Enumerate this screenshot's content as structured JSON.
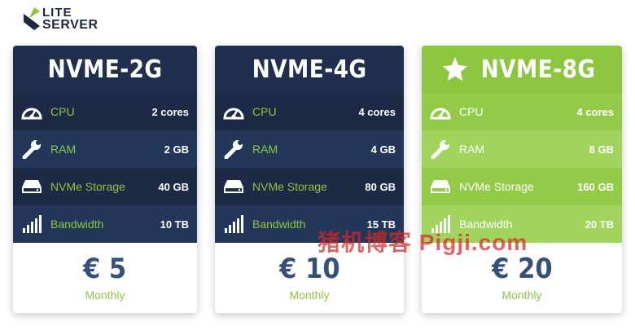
{
  "brand": {
    "line1": "LITE",
    "line2": "SERVER"
  },
  "plans": [
    {
      "name": "NVME-2G",
      "specs": [
        {
          "label": "CPU",
          "value": "2 cores",
          "icon": "speedometer-icon"
        },
        {
          "label": "RAM",
          "value": "2 GB",
          "icon": "wrench-icon"
        },
        {
          "label": "NVMe Storage",
          "value": "40 GB",
          "icon": "hard-drive-icon"
        },
        {
          "label": "Bandwidth",
          "value": "10 TB",
          "icon": "signal-bars-icon"
        }
      ],
      "price": "€ 5",
      "period": "Monthly"
    },
    {
      "name": "NVME-4G",
      "specs": [
        {
          "label": "CPU",
          "value": "4 cores",
          "icon": "speedometer-icon"
        },
        {
          "label": "RAM",
          "value": "4 GB",
          "icon": "wrench-icon"
        },
        {
          "label": "NVMe Storage",
          "value": "80 GB",
          "icon": "hard-drive-icon"
        },
        {
          "label": "Bandwidth",
          "value": "15 TB",
          "icon": "signal-bars-icon"
        }
      ],
      "price": "€ 10",
      "period": "Monthly"
    },
    {
      "name": "NVME-8G",
      "featured_icon": "star-icon",
      "specs": [
        {
          "label": "CPU",
          "value": "4 cores",
          "icon": "speedometer-icon"
        },
        {
          "label": "RAM",
          "value": "8 GB",
          "icon": "wrench-icon"
        },
        {
          "label": "NVMe Storage",
          "value": "160 GB",
          "icon": "hard-drive-icon"
        },
        {
          "label": "Bandwidth",
          "value": "20 TB",
          "icon": "signal-bars-icon"
        }
      ],
      "price": "€ 20",
      "period": "Monthly"
    }
  ],
  "watermark": "猪机博客 Pigji.com",
  "colors": {
    "navy": "#1f2f4d",
    "green": "#8cc63f",
    "price": "#36507a"
  }
}
